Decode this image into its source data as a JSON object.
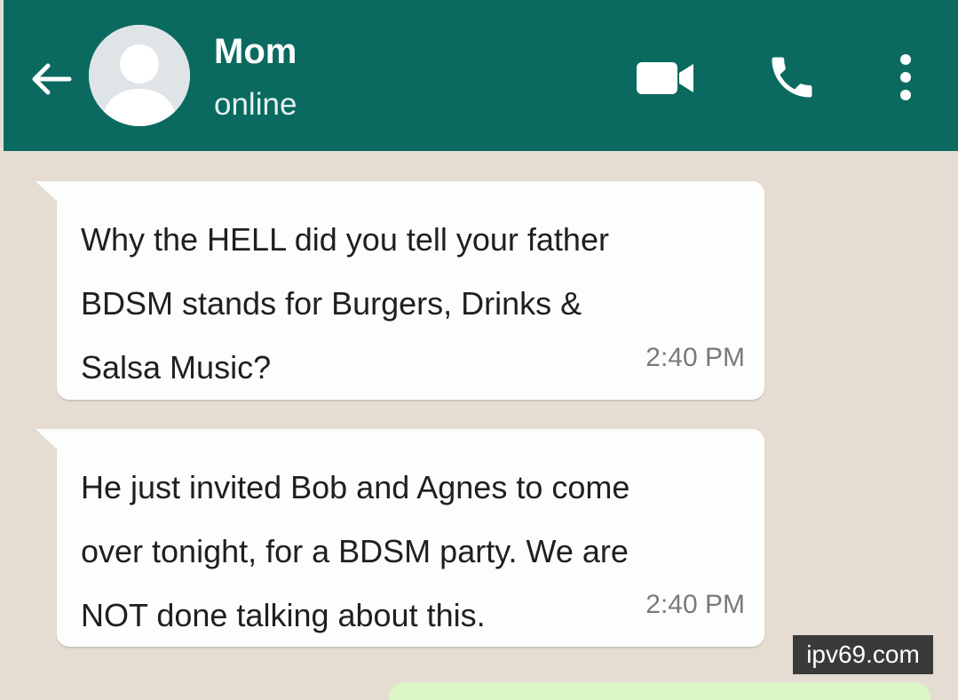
{
  "header": {
    "contact_name": "Mom",
    "status": "online",
    "background_color": "#0b6a5f",
    "icons": [
      "back-arrow-icon",
      "avatar-placeholder-icon",
      "video-camera-icon",
      "phone-icon",
      "more-vertical-icon"
    ]
  },
  "messages": [
    {
      "direction": "incoming",
      "text": "Why the HELL did you tell your father\nBDSM stands for Burgers, Drinks &\nSalsa Music?",
      "time": "2:40 PM"
    },
    {
      "direction": "incoming",
      "text": "He just invited Bob and Agnes to come\nover tonight, for a BDSM party. We are\nNOT done talking about this.",
      "time": "2:40 PM"
    }
  ],
  "watermark": "ipv69.com",
  "colors": {
    "chat_background": "#e5ddd2",
    "incoming_bubble": "#fdfdfd",
    "outgoing_bubble": "#dcf6c8"
  }
}
